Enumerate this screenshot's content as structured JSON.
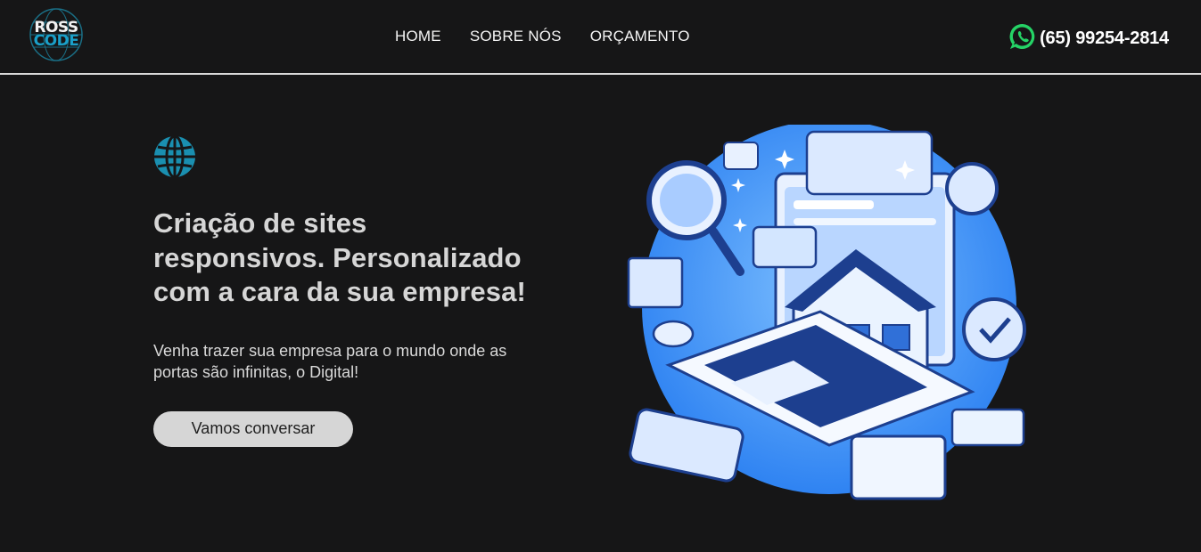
{
  "header": {
    "logo": {
      "line1": "ROSS",
      "line2": "CODE"
    },
    "nav": [
      {
        "label": "HOME"
      },
      {
        "label": "SOBRE NÓS"
      },
      {
        "label": "ORÇAMENTO"
      }
    ],
    "phone": {
      "icon": "whatsapp-icon",
      "number": "(65) 99254-2814"
    }
  },
  "hero": {
    "icon": "globe-icon",
    "headline": "Criação de sites responsivos. Personalizado com a cara da sua empresa!",
    "subtext": "Venha trazer sua empresa para o mundo onde as portas são infinitas, o Digital!",
    "cta_label": "Vamos conversar",
    "illustration": "isometric-house-laptop-illustration"
  },
  "colors": {
    "background": "#161617",
    "accent": "#1a8fb0",
    "whatsapp": "#25d366",
    "illustration_blue": "#3d8ff0"
  }
}
